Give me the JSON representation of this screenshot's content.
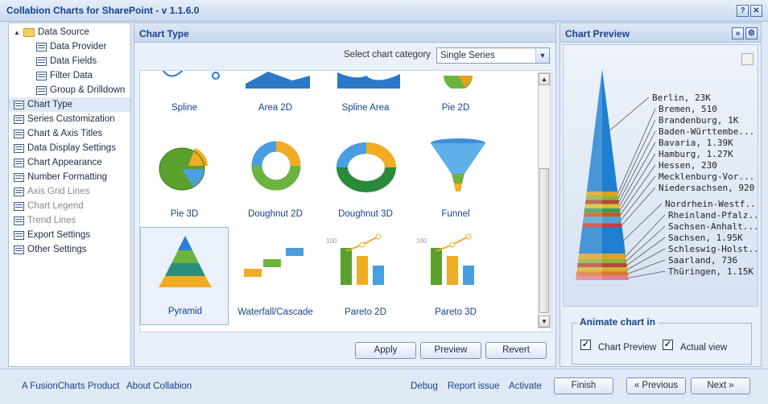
{
  "window": {
    "title": "Collabion Charts for SharePoint - v 1.1.6.0",
    "help_glyph": "?",
    "close_glyph": "✕"
  },
  "tree": {
    "items": [
      {
        "label": "Data Source",
        "level": 0,
        "type": "folder",
        "expander": "▲"
      },
      {
        "label": "Data Provider",
        "level": 1,
        "type": "node"
      },
      {
        "label": "Data Fields",
        "level": 1,
        "type": "node"
      },
      {
        "label": "Filter Data",
        "level": 1,
        "type": "node"
      },
      {
        "label": "Group & Drilldown",
        "level": 1,
        "type": "node"
      },
      {
        "label": "Chart Type",
        "level": 0,
        "type": "node",
        "selected": true
      },
      {
        "label": "Series Customization",
        "level": 0,
        "type": "node"
      },
      {
        "label": "Chart & Axis Titles",
        "level": 0,
        "type": "node"
      },
      {
        "label": "Data Display Settings",
        "level": 0,
        "type": "node"
      },
      {
        "label": "Chart Appearance",
        "level": 0,
        "type": "node"
      },
      {
        "label": "Number Formatting",
        "level": 0,
        "type": "node"
      },
      {
        "label": "Axis Grid Lines",
        "level": 0,
        "type": "node",
        "disabled": true
      },
      {
        "label": "Chart Legend",
        "level": 0,
        "type": "node",
        "disabled": true
      },
      {
        "label": "Trend Lines",
        "level": 0,
        "type": "node",
        "disabled": true
      },
      {
        "label": "Export Settings",
        "level": 0,
        "type": "node"
      },
      {
        "label": "Other Settings",
        "level": 0,
        "type": "node"
      }
    ]
  },
  "chart_type_panel": {
    "title": "Chart Type",
    "category_label": "Select chart category",
    "category_value": "Single Series",
    "tiles": [
      {
        "label": "Spline",
        "icon": "spline-chart-icon"
      },
      {
        "label": "Area 2D",
        "icon": "area-2d-chart-icon"
      },
      {
        "label": "Spline Area",
        "icon": "spline-area-chart-icon"
      },
      {
        "label": "Pie 2D",
        "icon": "pie-2d-chart-icon"
      },
      {
        "label": "Pie 3D",
        "icon": "pie-3d-chart-icon"
      },
      {
        "label": "Doughnut 2D",
        "icon": "doughnut-2d-chart-icon"
      },
      {
        "label": "Doughnut 3D",
        "icon": "doughnut-3d-chart-icon"
      },
      {
        "label": "Funnel",
        "icon": "funnel-chart-icon"
      },
      {
        "label": "Pyramid",
        "icon": "pyramid-chart-icon",
        "selected": true
      },
      {
        "label": "Waterfall/Cascade",
        "icon": "waterfall-chart-icon"
      },
      {
        "label": "Pareto 2D",
        "icon": "pareto-2d-chart-icon"
      },
      {
        "label": "Pareto 3D",
        "icon": "pareto-3d-chart-icon"
      }
    ],
    "pareto_axis_label": "100",
    "buttons": {
      "apply": "Apply",
      "preview": "Preview",
      "revert": "Revert"
    }
  },
  "preview_panel": {
    "title": "Chart Preview",
    "expand_glyph": "»",
    "settings_glyph": "⚙",
    "animate_title": "Animate chart in",
    "chart_preview_label": "Chart Preview",
    "chart_preview_checked": true,
    "actual_view_label": "Actual view",
    "actual_view_checked": true
  },
  "chart_data": {
    "type": "pyramid",
    "title": "",
    "labels": [
      "Berlin, 23K",
      "Bremen, 510",
      "Brandenburg, 1K",
      "Baden-Württembe...",
      "Bavaria, 1.39K",
      "Hamburg, 1.27K",
      "Hessen, 230",
      "Mecklenburg-Vor...",
      "Niedersachsen, 920",
      "Nordrhein-Westf...",
      "Rheinland-Pfalz...",
      "Sachsen-Anhalt...",
      "Sachsen, 1.95K",
      "Schleswig-Holst...",
      "Saarland, 736",
      "Thüringen, 1.15K"
    ],
    "colors": [
      "#1e7fd0",
      "#e0a020",
      "#8fb339",
      "#b04a3e",
      "#d7c030",
      "#3c9a5e",
      "#c45a1e",
      "#4da3d8",
      "#c83c3c",
      "#1e7fd0",
      "#e0a020",
      "#8fb339",
      "#b04a3e",
      "#d7b230",
      "#d9782a",
      "#e07a9a"
    ]
  },
  "footer": {
    "fusioncharts_link": "A FusionCharts Product",
    "about_link": "About Collabion",
    "debug_link": "Debug",
    "report_link": "Report issue",
    "activate_link": "Activate",
    "finish_button": "Finish",
    "previous_button": "« Previous",
    "next_button": "Next »"
  },
  "colors": {
    "accent": "#15428b",
    "panel": "#eaf0f9",
    "border": "#a8bedb"
  }
}
